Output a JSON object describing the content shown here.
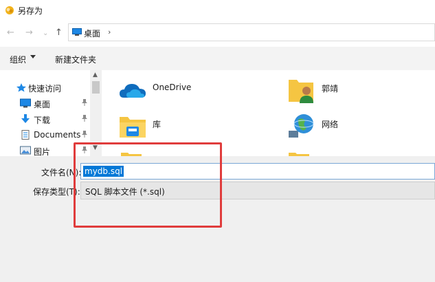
{
  "window": {
    "title": "另存为"
  },
  "nav": {
    "back": "←",
    "forward": "→",
    "recent": "⌄",
    "up": "↑",
    "breadcrumb": "桌面",
    "breadcrumb_chevron": "›"
  },
  "toolbar": {
    "organize": "组织",
    "new_folder": "新建文件夹"
  },
  "sidebar": {
    "items": [
      {
        "label": "快速访问",
        "icon": "star-icon"
      },
      {
        "label": "桌面",
        "icon": "desktop-icon"
      },
      {
        "label": "下载",
        "icon": "download-icon"
      },
      {
        "label": "Documents",
        "icon": "document-icon"
      },
      {
        "label": "图片",
        "icon": "pictures-icon"
      }
    ]
  },
  "files": [
    {
      "name": "OneDrive",
      "icon": "onedrive-cloud-icon"
    },
    {
      "name": "郭靖",
      "icon": "user-folder-icon"
    },
    {
      "name": "库",
      "icon": "library-folder-icon"
    },
    {
      "name": "网络",
      "icon": "network-globe-icon"
    }
  ],
  "bottom": {
    "filename_label": "文件名(N):",
    "filename_value": "mydb.sql",
    "filetype_label": "保存类型(T):",
    "filetype_value": "SQL 脚本文件 (*.sql)"
  },
  "colors": {
    "selection": "#0078d7",
    "highlight_box": "#e03c3c",
    "accent": "#1e88e5"
  }
}
